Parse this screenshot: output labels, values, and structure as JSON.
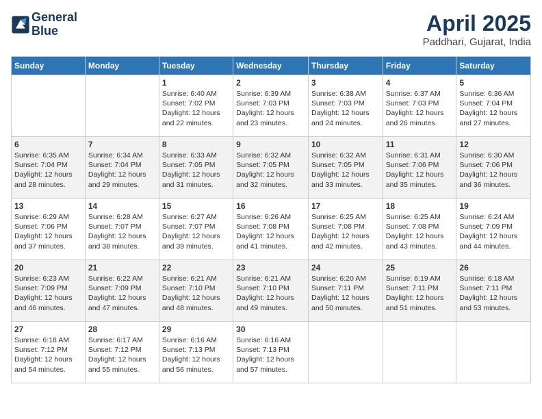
{
  "header": {
    "logo_line1": "General",
    "logo_line2": "Blue",
    "title": "April 2025",
    "subtitle": "Paddhari, Gujarat, India"
  },
  "weekdays": [
    "Sunday",
    "Monday",
    "Tuesday",
    "Wednesday",
    "Thursday",
    "Friday",
    "Saturday"
  ],
  "weeks": [
    [
      {
        "day": "",
        "sunrise": "",
        "sunset": "",
        "daylight": ""
      },
      {
        "day": "",
        "sunrise": "",
        "sunset": "",
        "daylight": ""
      },
      {
        "day": "1",
        "sunrise": "Sunrise: 6:40 AM",
        "sunset": "Sunset: 7:02 PM",
        "daylight": "Daylight: 12 hours and 22 minutes."
      },
      {
        "day": "2",
        "sunrise": "Sunrise: 6:39 AM",
        "sunset": "Sunset: 7:03 PM",
        "daylight": "Daylight: 12 hours and 23 minutes."
      },
      {
        "day": "3",
        "sunrise": "Sunrise: 6:38 AM",
        "sunset": "Sunset: 7:03 PM",
        "daylight": "Daylight: 12 hours and 24 minutes."
      },
      {
        "day": "4",
        "sunrise": "Sunrise: 6:37 AM",
        "sunset": "Sunset: 7:03 PM",
        "daylight": "Daylight: 12 hours and 26 minutes."
      },
      {
        "day": "5",
        "sunrise": "Sunrise: 6:36 AM",
        "sunset": "Sunset: 7:04 PM",
        "daylight": "Daylight: 12 hours and 27 minutes."
      }
    ],
    [
      {
        "day": "6",
        "sunrise": "Sunrise: 6:35 AM",
        "sunset": "Sunset: 7:04 PM",
        "daylight": "Daylight: 12 hours and 28 minutes."
      },
      {
        "day": "7",
        "sunrise": "Sunrise: 6:34 AM",
        "sunset": "Sunset: 7:04 PM",
        "daylight": "Daylight: 12 hours and 29 minutes."
      },
      {
        "day": "8",
        "sunrise": "Sunrise: 6:33 AM",
        "sunset": "Sunset: 7:05 PM",
        "daylight": "Daylight: 12 hours and 31 minutes."
      },
      {
        "day": "9",
        "sunrise": "Sunrise: 6:32 AM",
        "sunset": "Sunset: 7:05 PM",
        "daylight": "Daylight: 12 hours and 32 minutes."
      },
      {
        "day": "10",
        "sunrise": "Sunrise: 6:32 AM",
        "sunset": "Sunset: 7:05 PM",
        "daylight": "Daylight: 12 hours and 33 minutes."
      },
      {
        "day": "11",
        "sunrise": "Sunrise: 6:31 AM",
        "sunset": "Sunset: 7:06 PM",
        "daylight": "Daylight: 12 hours and 35 minutes."
      },
      {
        "day": "12",
        "sunrise": "Sunrise: 6:30 AM",
        "sunset": "Sunset: 7:06 PM",
        "daylight": "Daylight: 12 hours and 36 minutes."
      }
    ],
    [
      {
        "day": "13",
        "sunrise": "Sunrise: 6:29 AM",
        "sunset": "Sunset: 7:06 PM",
        "daylight": "Daylight: 12 hours and 37 minutes."
      },
      {
        "day": "14",
        "sunrise": "Sunrise: 6:28 AM",
        "sunset": "Sunset: 7:07 PM",
        "daylight": "Daylight: 12 hours and 38 minutes."
      },
      {
        "day": "15",
        "sunrise": "Sunrise: 6:27 AM",
        "sunset": "Sunset: 7:07 PM",
        "daylight": "Daylight: 12 hours and 39 minutes."
      },
      {
        "day": "16",
        "sunrise": "Sunrise: 6:26 AM",
        "sunset": "Sunset: 7:08 PM",
        "daylight": "Daylight: 12 hours and 41 minutes."
      },
      {
        "day": "17",
        "sunrise": "Sunrise: 6:25 AM",
        "sunset": "Sunset: 7:08 PM",
        "daylight": "Daylight: 12 hours and 42 minutes."
      },
      {
        "day": "18",
        "sunrise": "Sunrise: 6:25 AM",
        "sunset": "Sunset: 7:08 PM",
        "daylight": "Daylight: 12 hours and 43 minutes."
      },
      {
        "day": "19",
        "sunrise": "Sunrise: 6:24 AM",
        "sunset": "Sunset: 7:09 PM",
        "daylight": "Daylight: 12 hours and 44 minutes."
      }
    ],
    [
      {
        "day": "20",
        "sunrise": "Sunrise: 6:23 AM",
        "sunset": "Sunset: 7:09 PM",
        "daylight": "Daylight: 12 hours and 46 minutes."
      },
      {
        "day": "21",
        "sunrise": "Sunrise: 6:22 AM",
        "sunset": "Sunset: 7:09 PM",
        "daylight": "Daylight: 12 hours and 47 minutes."
      },
      {
        "day": "22",
        "sunrise": "Sunrise: 6:21 AM",
        "sunset": "Sunset: 7:10 PM",
        "daylight": "Daylight: 12 hours and 48 minutes."
      },
      {
        "day": "23",
        "sunrise": "Sunrise: 6:21 AM",
        "sunset": "Sunset: 7:10 PM",
        "daylight": "Daylight: 12 hours and 49 minutes."
      },
      {
        "day": "24",
        "sunrise": "Sunrise: 6:20 AM",
        "sunset": "Sunset: 7:11 PM",
        "daylight": "Daylight: 12 hours and 50 minutes."
      },
      {
        "day": "25",
        "sunrise": "Sunrise: 6:19 AM",
        "sunset": "Sunset: 7:11 PM",
        "daylight": "Daylight: 12 hours and 51 minutes."
      },
      {
        "day": "26",
        "sunrise": "Sunrise: 6:18 AM",
        "sunset": "Sunset: 7:11 PM",
        "daylight": "Daylight: 12 hours and 53 minutes."
      }
    ],
    [
      {
        "day": "27",
        "sunrise": "Sunrise: 6:18 AM",
        "sunset": "Sunset: 7:12 PM",
        "daylight": "Daylight: 12 hours and 54 minutes."
      },
      {
        "day": "28",
        "sunrise": "Sunrise: 6:17 AM",
        "sunset": "Sunset: 7:12 PM",
        "daylight": "Daylight: 12 hours and 55 minutes."
      },
      {
        "day": "29",
        "sunrise": "Sunrise: 6:16 AM",
        "sunset": "Sunset: 7:13 PM",
        "daylight": "Daylight: 12 hours and 56 minutes."
      },
      {
        "day": "30",
        "sunrise": "Sunrise: 6:16 AM",
        "sunset": "Sunset: 7:13 PM",
        "daylight": "Daylight: 12 hours and 57 minutes."
      },
      {
        "day": "",
        "sunrise": "",
        "sunset": "",
        "daylight": ""
      },
      {
        "day": "",
        "sunrise": "",
        "sunset": "",
        "daylight": ""
      },
      {
        "day": "",
        "sunrise": "",
        "sunset": "",
        "daylight": ""
      }
    ]
  ]
}
